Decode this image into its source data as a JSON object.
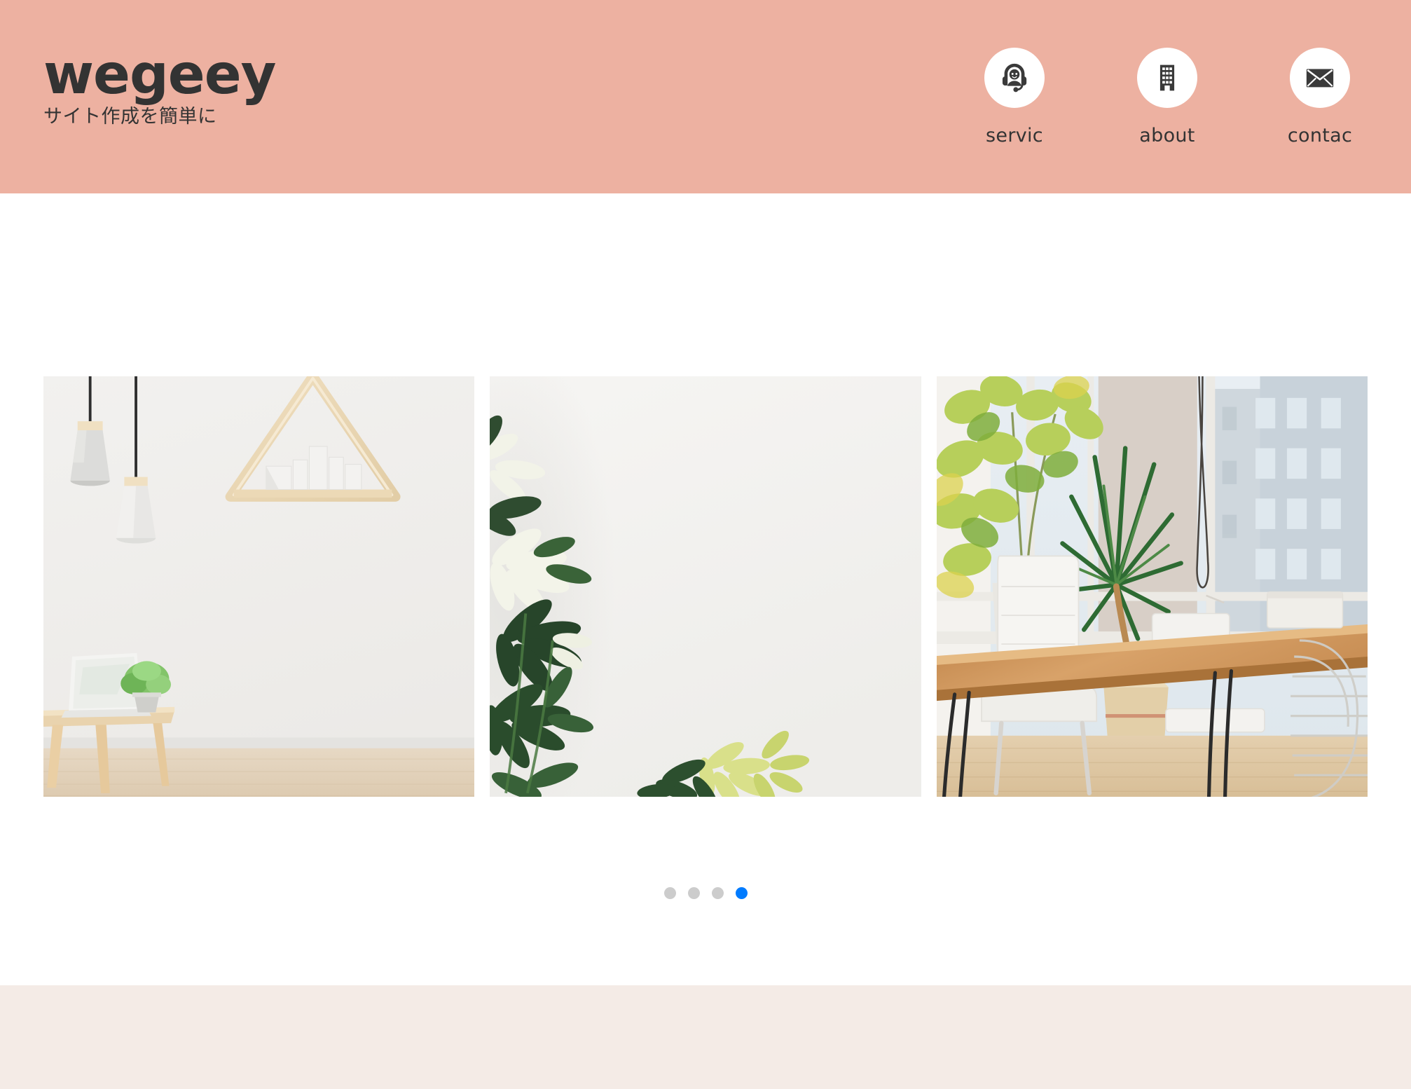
{
  "header": {
    "background_color": "#edb1a1",
    "brand": {
      "name": "wegeey",
      "tagline": "サイト作成を簡単に",
      "text_color": "#333333"
    },
    "nav": [
      {
        "label": "servic",
        "icon": "headset-support-icon"
      },
      {
        "label": "about",
        "icon": "office-building-icon"
      },
      {
        "label": "contac",
        "icon": "envelope-icon"
      }
    ]
  },
  "carousel": {
    "slides": [
      {
        "alt": "Minimalist white interior with two pendant lamps, triangular wooden wall shelf, small wooden table with laptop and potted plant"
      },
      {
        "alt": "Schefflera plants with variegated green and cream leaves against a plain white wall"
      },
      {
        "alt": "Bright office meeting room with wooden table, white chairs, tall potted plants and a window overlooking city buildings"
      }
    ],
    "dots": {
      "count": 4,
      "active_index": 3,
      "inactive_color": "#cccccc",
      "active_color": "#007bff"
    }
  },
  "lower_band": {
    "background_color": "#f4ebe6"
  }
}
